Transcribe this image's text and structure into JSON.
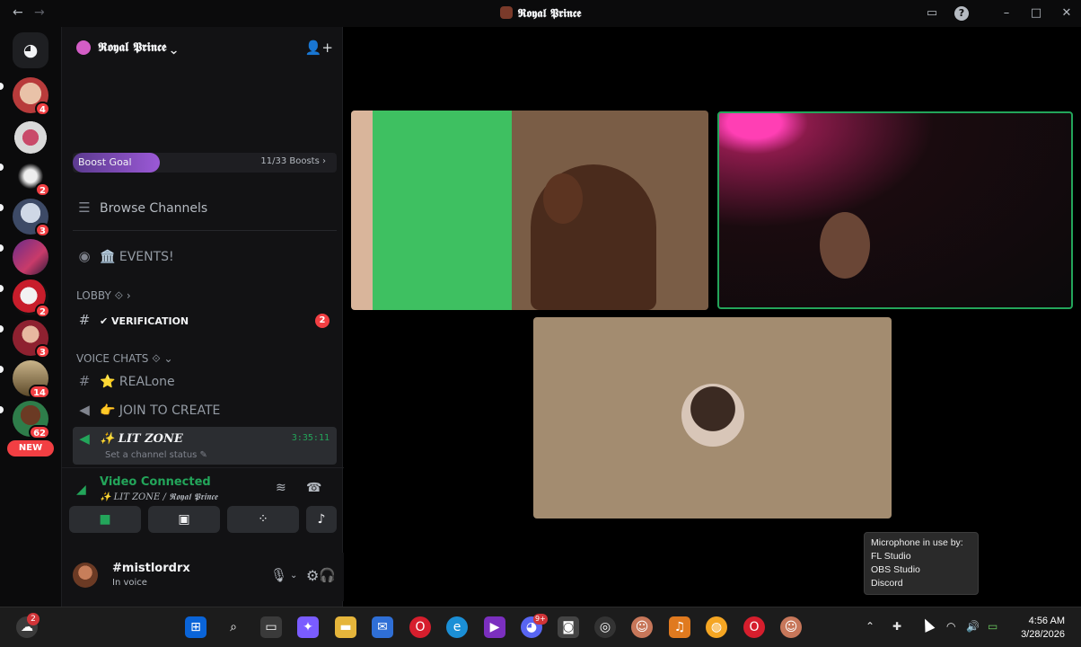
{
  "window": {
    "title": "𝕽𝖔𝖞𝖆𝖑 𝕻𝖗𝖎𝖓𝖈𝖊",
    "back": "←",
    "forward": "→"
  },
  "rail": {
    "badges": [
      "4",
      "2",
      "3",
      "2",
      "3",
      "14",
      "62"
    ],
    "new_label": "NEW"
  },
  "server": {
    "name": "𝕽𝖔𝖞𝖆𝖑 𝕻𝖗𝖎𝖓𝖈𝖊 ⌄",
    "boost_label": "Boost Goal",
    "boost_count": "11/33 Boosts ›",
    "boost_progress": 0.33
  },
  "channels": {
    "browse": "Browse Channels",
    "events": "🏛️ EVENTS!",
    "lobby_cat": "LOBBY ⟐ ›",
    "verification": "✔ VERIFICATION",
    "verification_badge": "2",
    "voice_cat": "VOICE CHATS ⟐ ⌄",
    "realone": "⭐ REALone",
    "join_to_create": "👉 JOIN TO CREATE",
    "lit_zone": "✨ LIT ZONE",
    "lit_zone_timer": "3:35:11",
    "lit_zone_status": "Set a channel status ✎"
  },
  "voice": {
    "status": "Video Connected",
    "location": "✨ LIT ZONE / 𝕽𝖔𝖞𝖆𝖑 𝕻𝖗𝖎𝖓𝖈𝖊"
  },
  "user": {
    "name": "#mistlordrx",
    "status": "In voice"
  },
  "tooltip": {
    "lines": [
      "Microphone in use by:",
      "FL Studio",
      "OBS Studio",
      "Discord"
    ]
  },
  "taskbar": {
    "time": "4:56 AM",
    "date": "3/28/2026",
    "notif_count": "2",
    "discord_badge": "9+"
  }
}
